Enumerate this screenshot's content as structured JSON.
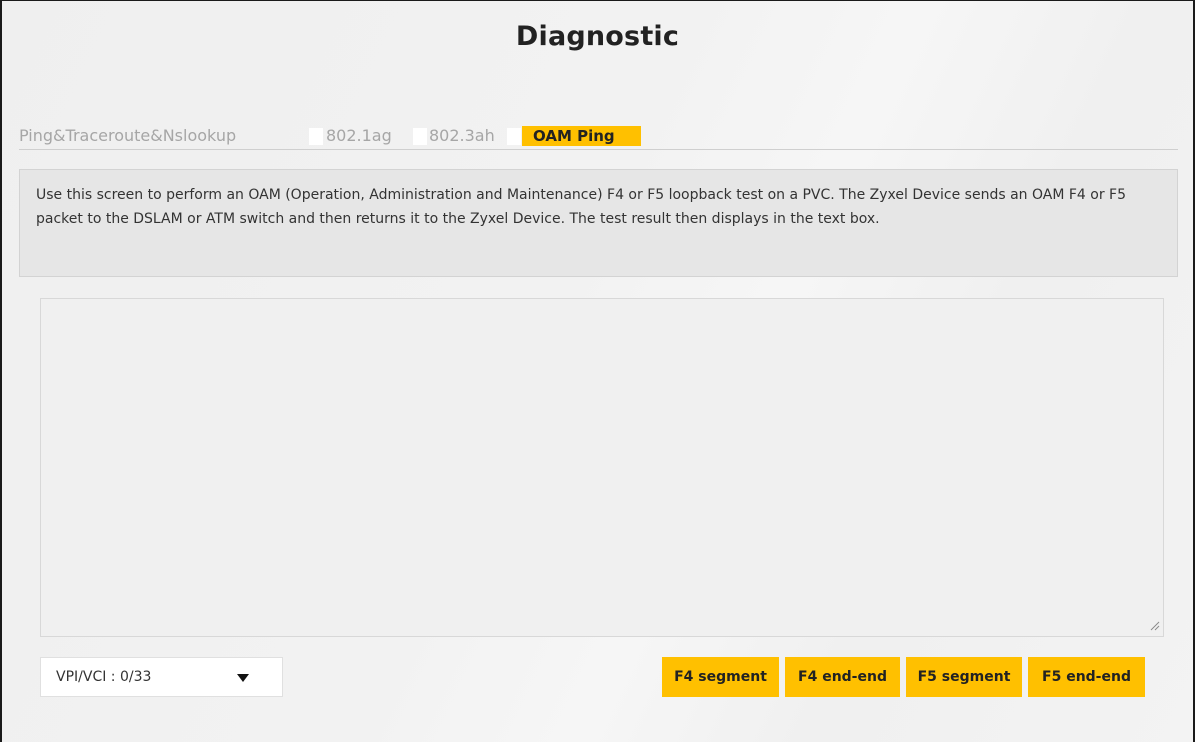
{
  "page": {
    "title": "Diagnostic"
  },
  "tabs": [
    {
      "label": "Ping&Traceroute&Nslookup",
      "active": false
    },
    {
      "label": "802.1ag",
      "active": false
    },
    {
      "label": "802.3ah",
      "active": false
    },
    {
      "label": "OAM Ping",
      "active": true
    }
  ],
  "description": "Use this screen to perform an OAM (Operation, Administration and Maintenance) F4 or F5 loopback test on a PVC. The Zyxel Device sends an OAM F4 or F5 packet to the DSLAM or ATM switch and then returns it to the Zyxel Device. The test result then displays in the text box.",
  "result_box": {
    "value": ""
  },
  "vpi_vci_select": {
    "selected": "VPI/VCI : 0/33",
    "icon": "caret-down-icon"
  },
  "buttons": {
    "f4_segment": "F4 segment",
    "f4_end_end": "F4 end-end",
    "f5_segment": "F5 segment",
    "f5_end_end": "F5 end-end"
  },
  "colors": {
    "accent": "#ffc000",
    "inactive_tab_text": "#a6a6a6",
    "description_bg": "#e6e6e6"
  }
}
